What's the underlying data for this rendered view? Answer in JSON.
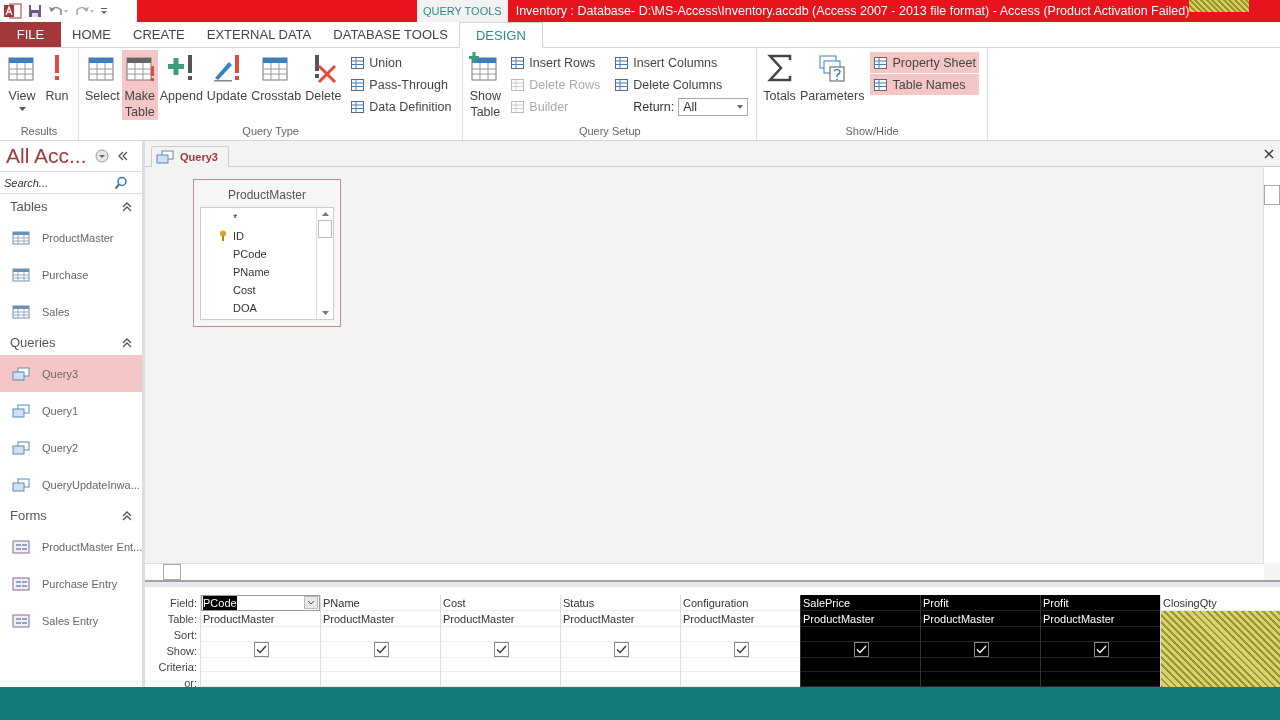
{
  "window": {
    "title": "Inventory : Database- D:\\MS-Access\\Inventory.accdb (Access 2007 - 2013 file format) -  Access (Product Activation Failed)",
    "context_tab": "QUERY TOOLS"
  },
  "tabs": [
    {
      "label": "FILE",
      "kind": "file",
      "selected": false
    },
    {
      "label": "HOME",
      "kind": "tab",
      "selected": false
    },
    {
      "label": "CREATE",
      "kind": "tab",
      "selected": false
    },
    {
      "label": "EXTERNAL DATA",
      "kind": "tab",
      "selected": false
    },
    {
      "label": "DATABASE TOOLS",
      "kind": "tab",
      "selected": false
    },
    {
      "label": "DESIGN",
      "kind": "tab",
      "selected": true
    }
  ],
  "ribbon": [
    {
      "label": "Results",
      "items": [
        {
          "kind": "large",
          "label": "View",
          "dropdown": true,
          "selected": false
        },
        {
          "kind": "large",
          "label": "Run",
          "selected": false
        }
      ]
    },
    {
      "label": "Query Type",
      "items": [
        {
          "kind": "large",
          "label": "Select",
          "selected": false
        },
        {
          "kind": "large",
          "label": "Make Table",
          "selected": true
        },
        {
          "kind": "large",
          "label": "Append",
          "selected": false
        },
        {
          "kind": "large",
          "label": "Update",
          "selected": false
        },
        {
          "kind": "large",
          "label": "Crosstab",
          "selected": false
        },
        {
          "kind": "large",
          "label": "Delete",
          "selected": false
        },
        {
          "kind": "stack",
          "items": [
            {
              "label": "Union",
              "disabled": false,
              "selected": false
            },
            {
              "label": "Pass-Through",
              "disabled": false,
              "selected": false
            },
            {
              "label": "Data Definition",
              "disabled": false,
              "selected": false
            }
          ]
        }
      ]
    },
    {
      "label": "Query Setup",
      "items": [
        {
          "kind": "large",
          "label": "Show Table",
          "selected": false
        },
        {
          "kind": "stack",
          "items": [
            {
              "label": "Insert Rows",
              "disabled": false,
              "selected": false
            },
            {
              "label": "Delete Rows",
              "disabled": true,
              "selected": false
            },
            {
              "label": "Builder",
              "disabled": true,
              "selected": false
            }
          ]
        },
        {
          "kind": "stack",
          "items": [
            {
              "label": "Insert Columns",
              "disabled": false,
              "selected": false
            },
            {
              "label": "Delete Columns",
              "disabled": false,
              "selected": false
            }
          ],
          "combo": {
            "label": "Return:",
            "value": "All"
          }
        }
      ]
    },
    {
      "label": "Show/Hide",
      "items": [
        {
          "kind": "large",
          "label": "Totals",
          "selected": false
        },
        {
          "kind": "large",
          "label": "Parameters",
          "selected": false
        },
        {
          "kind": "stack",
          "items": [
            {
              "label": "Property Sheet",
              "disabled": false,
              "selected": true
            },
            {
              "label": "Table Names",
              "disabled": false,
              "selected": true
            }
          ]
        }
      ]
    }
  ],
  "nav": {
    "title": "All Acc...",
    "search": {
      "placeholder": "Search..."
    },
    "sections": [
      {
        "label": "Tables",
        "kind": "table",
        "items": [
          {
            "label": "ProductMaster",
            "selected": false
          },
          {
            "label": "Purchase",
            "selected": false
          },
          {
            "label": "Sales",
            "selected": false
          }
        ]
      },
      {
        "label": "Queries",
        "kind": "query",
        "items": [
          {
            "label": "Query3",
            "selected": true
          },
          {
            "label": "Query1",
            "selected": false
          },
          {
            "label": "Query2",
            "selected": false
          },
          {
            "label": "QueryUpdateInwa...",
            "selected": false
          }
        ]
      },
      {
        "label": "Forms",
        "kind": "form",
        "items": [
          {
            "label": "ProductMaster Ent...",
            "selected": false
          },
          {
            "label": "Purchase Entry",
            "selected": false
          },
          {
            "label": "Sales Entry",
            "selected": false
          }
        ]
      }
    ]
  },
  "document_tab": {
    "label": "Query3"
  },
  "table_box": {
    "title": "ProductMaster",
    "fields": [
      {
        "label": "*",
        "key": false
      },
      {
        "label": "ID",
        "key": true
      },
      {
        "label": "PCode",
        "key": false
      },
      {
        "label": "PName",
        "key": false
      },
      {
        "label": "Cost",
        "key": false
      },
      {
        "label": "DOA",
        "key": false
      }
    ]
  },
  "grid": {
    "row_labels": [
      "Field:",
      "Table:",
      "Sort:",
      "Show:",
      "Criteria:",
      "or:"
    ],
    "columns": [
      {
        "field": "PCode",
        "table": "ProductMaster",
        "show": true,
        "kind": "normal",
        "active": true
      },
      {
        "field": "PName",
        "table": "ProductMaster",
        "show": true,
        "kind": "normal",
        "active": false
      },
      {
        "field": "Cost",
        "table": "ProductMaster",
        "show": true,
        "kind": "normal",
        "active": false
      },
      {
        "field": "Status",
        "table": "ProductMaster",
        "show": true,
        "kind": "normal",
        "active": false
      },
      {
        "field": "Configuration",
        "table": "ProductMaster",
        "show": true,
        "kind": "normal",
        "active": false
      },
      {
        "field": "SalePrice",
        "table": "ProductMaster",
        "show": true,
        "kind": "selected",
        "active": false
      },
      {
        "field": "Profit",
        "table": "ProductMaster",
        "show": true,
        "kind": "selected",
        "active": false
      },
      {
        "field": "Profit",
        "table": "ProductMaster",
        "show": true,
        "kind": "selected",
        "active": false
      },
      {
        "field": "ClosingQty",
        "kind": "hatched",
        "active": false
      }
    ]
  }
}
